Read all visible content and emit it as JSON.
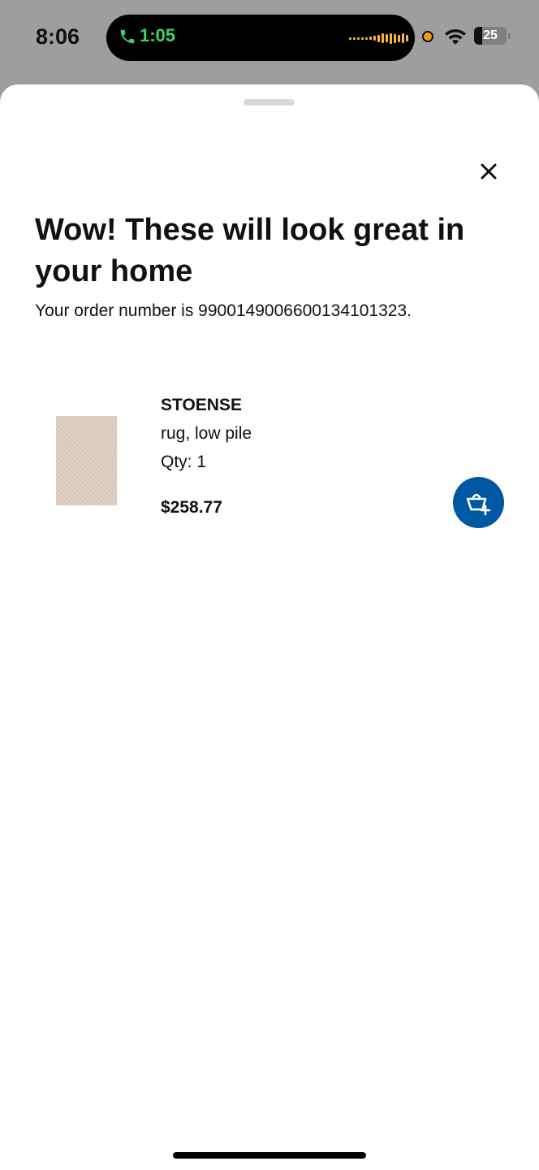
{
  "status_bar": {
    "time": "8:06",
    "call_time": "1:05",
    "battery": "25",
    "call_color": "#39d463",
    "mic_indicator_color": "#f39c12"
  },
  "sheet": {
    "title": "Wow! These will look great in your home",
    "order_text": "Your order number is 990014900660013410132​3.",
    "close_icon": "close-icon"
  },
  "product": {
    "name": "STOENSE",
    "description": "rug, low pile",
    "quantity": "Qty: 1",
    "price": "$258.77",
    "image_color": "#ddcdc0",
    "action_icon": "add-to-cart-icon",
    "action_color": "#0058a3"
  }
}
